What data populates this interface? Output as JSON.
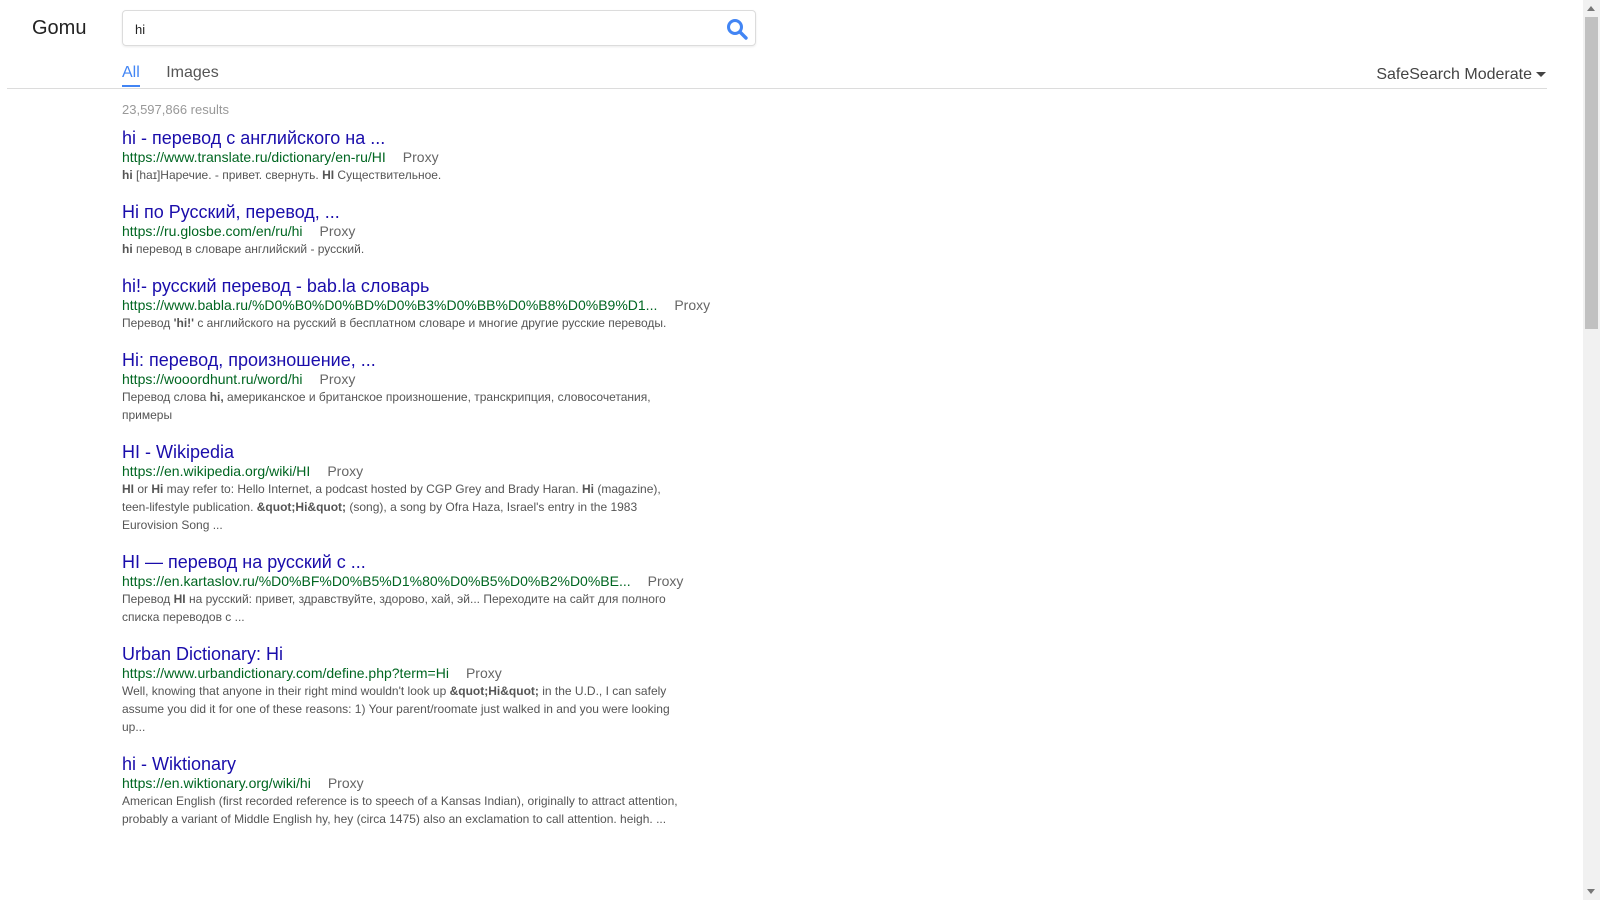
{
  "header": {
    "logo": "Gomu",
    "search": {
      "value": "hi",
      "placeholder": ""
    },
    "search_icon": "search-icon"
  },
  "tabs": [
    {
      "label": "All",
      "active": true
    },
    {
      "label": "Images",
      "active": false
    }
  ],
  "safesearch": {
    "label": "SafeSearch Moderate"
  },
  "results_count": "23,597,866 results",
  "results": [
    {
      "title": "hi - перевод с английского на ...",
      "url": "https://www.translate.ru/dictionary/en-ru/HI",
      "proxy": "Proxy",
      "snippet": "<b>hi</b> [haɪ]Наречие. - привет. свернуть. <b>HI</b> Существительное."
    },
    {
      "title": "Hi по Русский, перевод, ...",
      "url": "https://ru.glosbe.com/en/ru/hi",
      "proxy": "Proxy",
      "snippet": "<b>hi</b> перевод в словаре английский - русский."
    },
    {
      "title": "hi!- русский перевод - bab.la словарь",
      "url": "https://www.babla.ru/%D0%B0%D0%BD%D0%B3%D0%BB%D0%B8%D0%B9%D1...",
      "proxy": "Proxy",
      "snippet": "Перевод <b>'hi!'</b> с английского на русский в бесплатном словаре и многие другие русские переводы."
    },
    {
      "title": "Hi: перевод, произношение, ...",
      "url": "https://wooordhunt.ru/word/hi",
      "proxy": "Proxy",
      "snippet": "Перевод слова <b>hi,</b> американское и британское произношение, транскрипция, словосочетания, примеры"
    },
    {
      "title": "HI - Wikipedia",
      "url": "https://en.wikipedia.org/wiki/HI",
      "proxy": "Proxy",
      "snippet": "<b>HI</b> or <b>Hi</b> may refer to: Hello Internet, a podcast hosted by CGP Grey and Brady Haran. <b>Hi</b> (magazine), teen-lifestyle publication. <b>&amp;quot;Hi&amp;quot;</b> (song), a song by Ofra Haza, Israel's entry in the 1983 Eurovision Song ..."
    },
    {
      "title": "HI — перевод на русский с ...",
      "url": "https://en.kartaslov.ru/%D0%BF%D0%B5%D1%80%D0%B5%D0%B2%D0%BE...",
      "proxy": "Proxy",
      "snippet": "Перевод <b>HI</b> на русский: привет, здравствуйте, здорово, хай, эй... Переходите на сайт для полного списка переводов с ..."
    },
    {
      "title": "Urban Dictionary: Hi",
      "url": "https://www.urbandictionary.com/define.php?term=Hi",
      "proxy": "Proxy",
      "snippet": "Well, knowing that anyone in their right mind wouldn't look up <b>&amp;quot;Hi&amp;quot;</b> in the U.D., I can safely assume you did it for one of these reasons: 1) Your parent/roomate just walked in and you were looking up..."
    },
    {
      "title": "hi - Wiktionary",
      "url": "https://en.wiktionary.org/wiki/hi",
      "proxy": "Proxy",
      "snippet": "American English (first recorded reference is to speech of a Kansas Indian), originally to attract attention, probably a variant of Middle English hy, hey (circa 1475) also an exclamation to call attention. heigh. ..."
    }
  ],
  "colors": {
    "link": "#1a0dab",
    "url": "#006621",
    "accent": "#4285f4"
  }
}
